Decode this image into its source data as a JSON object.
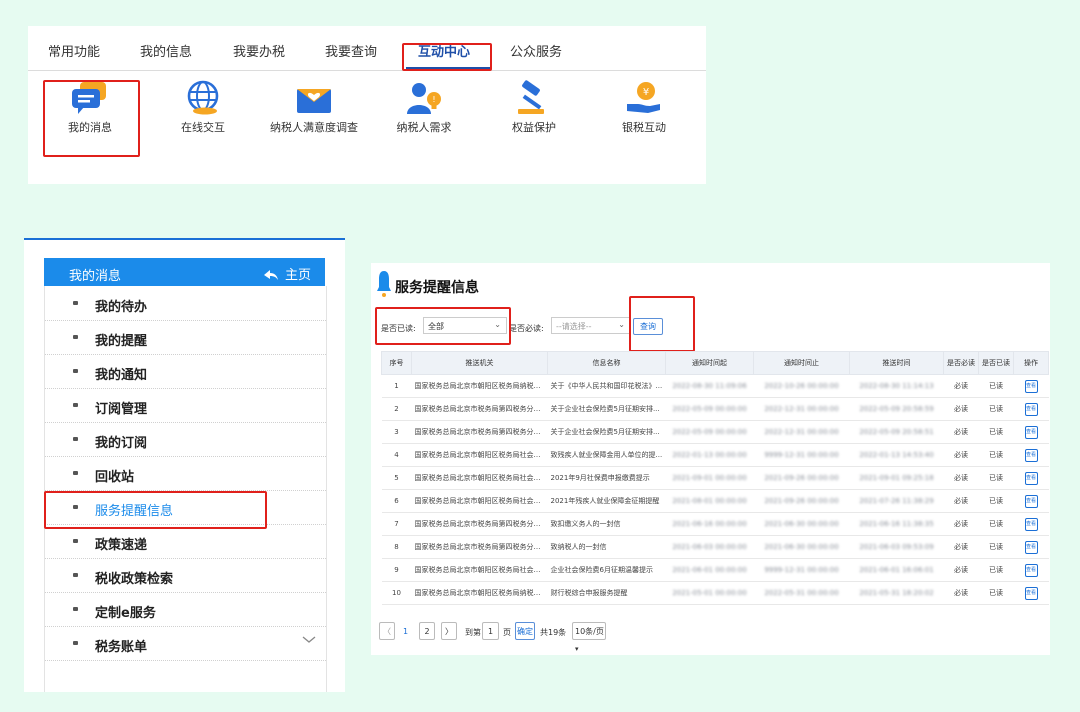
{
  "top": {
    "tabs": [
      "常用功能",
      "我的信息",
      "我要办税",
      "我要查询",
      "互动中心",
      "公众服务"
    ],
    "features": [
      {
        "label": "我的消息",
        "icon": "message-icon"
      },
      {
        "label": "在线交互",
        "icon": "globe-icon"
      },
      {
        "label": "纳税人满意度调查",
        "icon": "envelope-heart-icon"
      },
      {
        "label": "纳税人需求",
        "icon": "user-idea-icon"
      },
      {
        "label": "权益保护",
        "icon": "gavel-icon"
      },
      {
        "label": "银税互动",
        "icon": "hand-coin-icon"
      }
    ]
  },
  "sidebar": {
    "title": "我的消息",
    "home": "主页",
    "items": [
      "我的待办",
      "我的提醒",
      "我的通知",
      "订阅管理",
      "我的订阅",
      "回收站",
      "服务提醒信息",
      "政策速递",
      "税收政策检索",
      "定制e服务",
      "税务账单"
    ]
  },
  "service": {
    "title": "服务提醒信息",
    "filter_read_label": "是否已读:",
    "filter_read_value": "全部",
    "filter_must_label": "是否必读:",
    "filter_must_placeholder": "--请选择--",
    "query_label": "查询",
    "columns": [
      "序号",
      "推送机关",
      "信息名称",
      "通知时间起",
      "通知时间止",
      "推送时间",
      "是否必读",
      "是否已读",
      "操作"
    ],
    "rows": [
      [
        "1",
        "国家税务总局北京市朝阳区税务局纳税服务科",
        "关于《中华人民共和国印花税法》...",
        "2022-08-30 11:09:06",
        "2022-10-26 00:00:00",
        "2022-08-30 11:14:13",
        "必读",
        "已读",
        "查看"
      ],
      [
        "2",
        "国家税务总局北京市税务局第四税务分局局站...",
        "关于企业社会保险费5月征期安排...",
        "2022-05-09 00:00:00",
        "2022-12-31 00:00:00",
        "2022-05-09 20:58:59",
        "必读",
        "已读",
        "查看"
      ],
      [
        "3",
        "国家税务总局北京市税务局第四税务分局局站...",
        "关于企业社会保险费5月征期安排...",
        "2022-05-09 00:00:00",
        "2022-12-31 00:00:00",
        "2022-05-09 20:58:51",
        "必读",
        "已读",
        "查看"
      ],
      [
        "4",
        "国家税务总局北京市朝阳区税务局社会保险费...",
        "致残疾人就业保障金用人单位的提...",
        "2022-01-13 00:00:00",
        "9999-12-31 00:00:00",
        "2022-01-13 14:53:40",
        "必读",
        "已读",
        "查看"
      ],
      [
        "5",
        "国家税务总局北京市朝阳区税务局社会保险费...",
        "2021年9月社保费申报缴费提示",
        "2021-09-01 00:00:00",
        "2021-09-26 00:00:00",
        "2021-09-01 09:25:18",
        "必读",
        "已读",
        "查看"
      ],
      [
        "6",
        "国家税务总局北京市朝阳区税务局社会保险费...",
        "2021年残疾人就业保障金征期提醒",
        "2021-08-01 00:00:00",
        "2021-09-26 00:00:00",
        "2021-07-26 11:38:29",
        "必读",
        "已读",
        "查看"
      ],
      [
        "7",
        "国家税务总局北京市税务局第四税务分局局站...",
        "致扣缴义务人的一封信",
        "2021-06-16 00:00:00",
        "2021-06-30 00:00:00",
        "2021-06-16 11:38:35",
        "必读",
        "已读",
        "查看"
      ],
      [
        "8",
        "国家税务总局北京市税务局第四税务分局局站...",
        "致纳税人的一封信",
        "2021-06-03 00:00:00",
        "2021-06-30 00:00:00",
        "2021-06-03 09:53:09",
        "必读",
        "已读",
        "查看"
      ],
      [
        "9",
        "国家税务总局北京市朝阳区税务局社会保险费...",
        "企业社会保险费6月征期温馨提示",
        "2021-06-01 00:00:00",
        "9999-12-31 00:00:00",
        "2021-06-01 16:06:01",
        "必读",
        "已读",
        "查看"
      ],
      [
        "10",
        "国家税务总局北京市朝阳区税务局纳税服务科",
        "财行税综合申报服务提醒",
        "2021-05-01 00:00:00",
        "2022-05-31 00:00:00",
        "2021-05-31 18:20:02",
        "必读",
        "已读",
        "查看"
      ]
    ],
    "pager": {
      "prev": "〈",
      "page1": "1",
      "page2": "2",
      "next": "〉",
      "goto_label": "到第",
      "goto_value": "1",
      "page_unit": "页",
      "confirm": "确定",
      "total": "共19条",
      "per_page": "10条/页"
    }
  },
  "colors": {
    "background": "#e6fbf1",
    "highlight_border": "#e0201b",
    "accent_blue": "#1b8bea",
    "tab_active": "#1f4fa8"
  }
}
